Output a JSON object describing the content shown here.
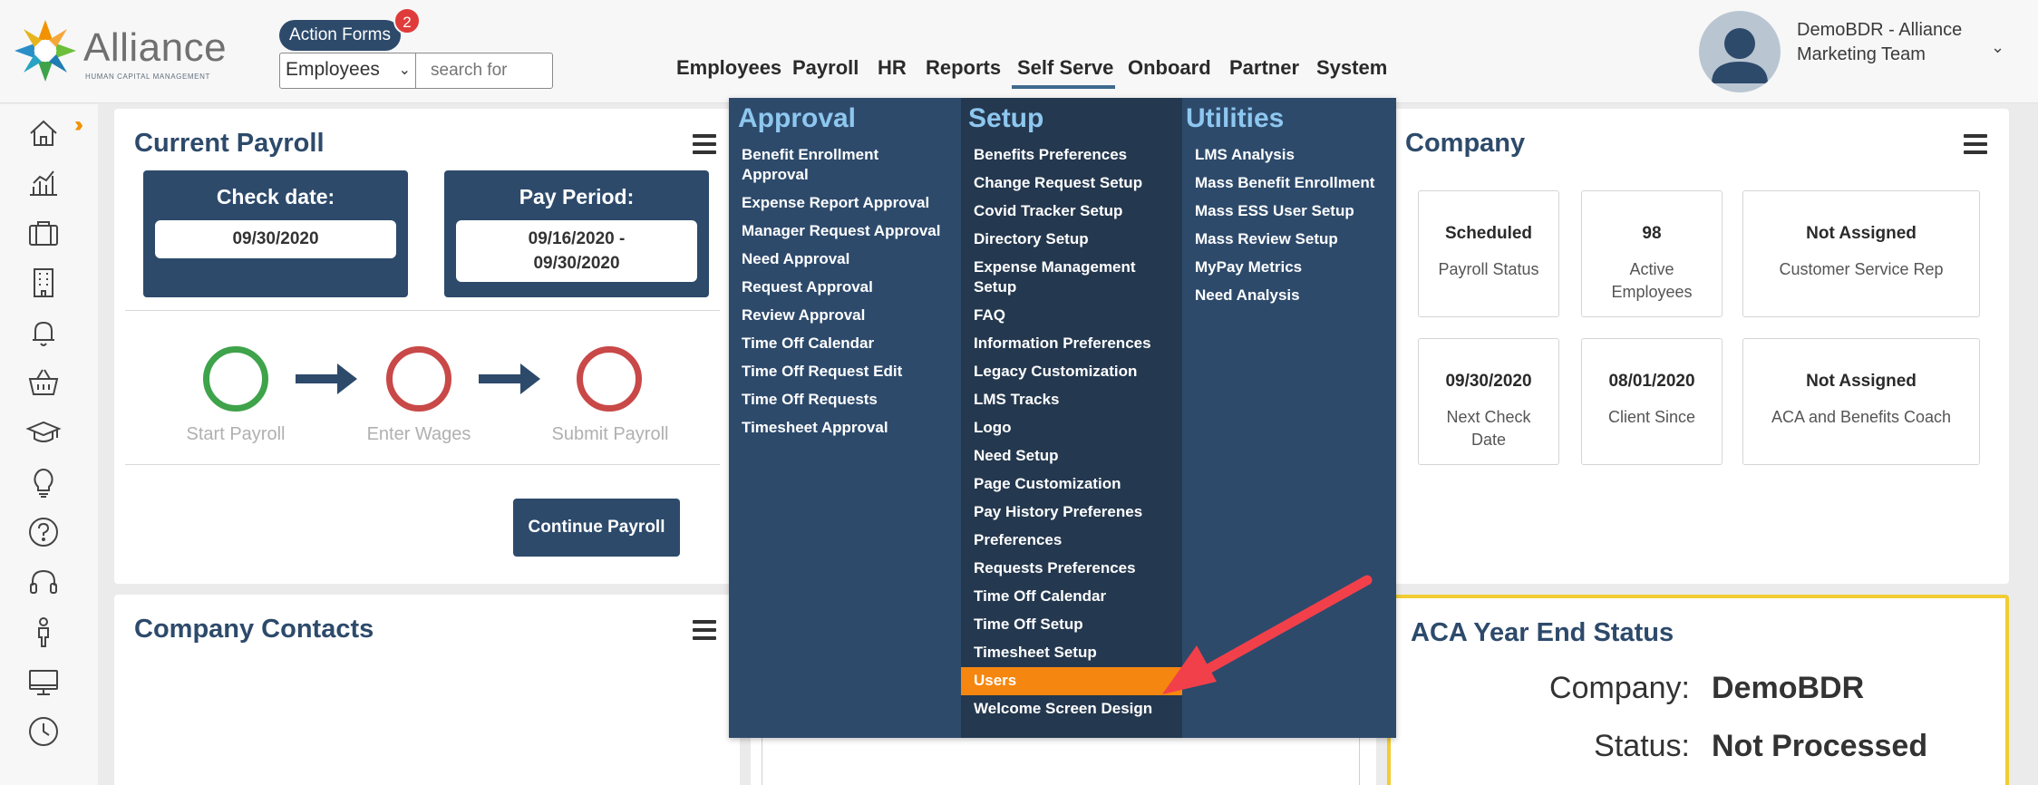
{
  "header": {
    "logo_text": "Alliance",
    "logo_subtitle": "HUMAN CAPITAL MANAGEMENT",
    "action_forms_label": "Action Forms",
    "action_forms_badge": "2",
    "employee_select_value": "Employees",
    "search_placeholder": "search for",
    "nav": [
      "Employees",
      "Payroll",
      "HR",
      "Reports",
      "Self Serve",
      "Onboard",
      "Partner",
      "System"
    ],
    "active_nav": "Self Serve",
    "user_name": "DemoBDR - Alliance Marketing Team"
  },
  "sidebar": {
    "icons": [
      "home-icon",
      "analytics-icon",
      "briefcase-icon",
      "building-icon",
      "bell-icon",
      "basket-icon",
      "graduation-cap-icon",
      "lightbulb-icon",
      "help-icon",
      "headset-icon",
      "person-icon",
      "monitor-icon",
      "clock-icon"
    ],
    "expand_icon": "double-chevron-right-icon"
  },
  "current_payroll": {
    "title": "Current Payroll",
    "check_date_label": "Check date:",
    "check_date_value": "09/30/2020",
    "pay_period_label": "Pay Period:",
    "pay_period_value_line1": "09/16/2020 -",
    "pay_period_value_line2": "09/30/2020",
    "steps": [
      "Start Payroll",
      "Enter Wages",
      "Submit Payroll"
    ],
    "continue_button": "Continue Payroll",
    "colors": {
      "start": "#3ea34a",
      "pending": "#c94848",
      "arrow": "#2d4a6b"
    }
  },
  "company": {
    "title": "Company",
    "boxes": [
      {
        "value": "Scheduled",
        "label": "Payroll Status"
      },
      {
        "value": "98",
        "label": "Active Employees"
      },
      {
        "value": "Not Assigned",
        "label": "Customer Service Rep"
      },
      {
        "value": "09/30/2020",
        "label": "Next Check Date"
      },
      {
        "value": "08/01/2020",
        "label": "Client Since"
      },
      {
        "value": "Not Assigned",
        "label": "ACA and Benefits Coach"
      }
    ]
  },
  "company_contacts": {
    "title": "Company Contacts"
  },
  "aca": {
    "title": "ACA Year End Status",
    "company_label": "Company:",
    "company_value": "DemoBDR",
    "status_label": "Status:",
    "status_value": "Not Processed"
  },
  "self_serve_menu": {
    "approval": {
      "heading": "Approval",
      "items": [
        "Benefit Enrollment Approval",
        "Expense Report Approval",
        "Manager Request Approval",
        "Need Approval",
        "Request Approval",
        "Review Approval",
        "Time Off Calendar",
        "Time Off Request Edit",
        "Time Off Requests",
        "Timesheet Approval"
      ]
    },
    "setup": {
      "heading": "Setup",
      "items": [
        "Benefits Preferences",
        "Change Request Setup",
        "Covid Tracker Setup",
        "Directory Setup",
        "Expense Management Setup",
        "FAQ",
        "Information Preferences",
        "Legacy Customization",
        "LMS Tracks",
        "Logo",
        "Need Setup",
        "Page Customization",
        "Pay History Preferenes",
        "Preferences",
        "Requests Preferences",
        "Time Off Calendar",
        "Time Off Setup",
        "Timesheet Setup",
        "Users",
        "Welcome Screen Design"
      ],
      "highlighted": "Users"
    },
    "utilities": {
      "heading": "Utilities",
      "items": [
        "LMS Analysis",
        "Mass Benefit Enrollment",
        "Mass ESS User Setup",
        "Mass Review Setup",
        "MyPay Metrics",
        "Need Analysis"
      ]
    },
    "highlight_color": "#f5860f"
  },
  "annotation_arrow_color": "#f2404a"
}
